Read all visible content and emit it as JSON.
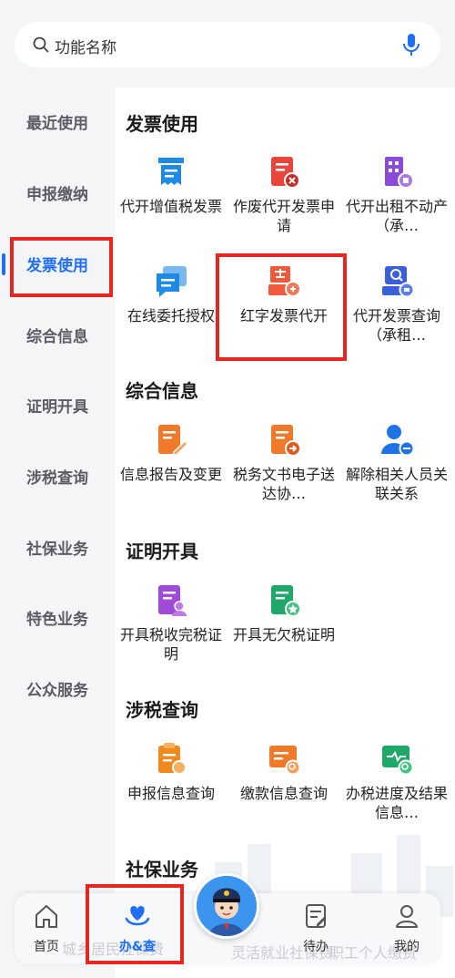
{
  "search": {
    "placeholder": "功能名称"
  },
  "sidebar": {
    "items": [
      {
        "label": "最近使用"
      },
      {
        "label": "申报缴纳"
      },
      {
        "label": "发票使用"
      },
      {
        "label": "综合信息"
      },
      {
        "label": "证明开具"
      },
      {
        "label": "涉税查询"
      },
      {
        "label": "社保业务"
      },
      {
        "label": "特色业务"
      },
      {
        "label": "公众服务"
      }
    ]
  },
  "sections": [
    {
      "title": "发票使用",
      "items": [
        {
          "label": "代开增值税发票",
          "icon": "invoice-icon",
          "color": "#1e8ae6"
        },
        {
          "label": "作废代开发票申请",
          "icon": "cancel-invoice-icon",
          "color": "#e8453c"
        },
        {
          "label": "代开出租不动产（承…",
          "icon": "building-icon",
          "color": "#8a4bd8"
        },
        {
          "label": "在线委托授权",
          "icon": "chat-authorize-icon",
          "color": "#1e8ae6"
        },
        {
          "label": "红字发票代开",
          "icon": "red-invoice-icon",
          "color": "#f05a3a"
        },
        {
          "label": "代开发票查询（承租…",
          "icon": "invoice-search-icon",
          "color": "#3a5fd8"
        }
      ]
    },
    {
      "title": "综合信息",
      "items": [
        {
          "label": "信息报告及变更",
          "icon": "edit-report-icon",
          "color": "#f07a2a"
        },
        {
          "label": "税务文书电子送达协…",
          "icon": "document-send-icon",
          "color": "#f07a2a"
        },
        {
          "label": "解除相关人员关联关系",
          "icon": "remove-user-icon",
          "color": "#1e72e6"
        }
      ]
    },
    {
      "title": "证明开具",
      "items": [
        {
          "label": "开具税收完税证明",
          "icon": "tax-certificate-icon",
          "color": "#a04bd8"
        },
        {
          "label": "开具无欠税证明",
          "icon": "no-arrears-certificate-icon",
          "color": "#1fa868"
        }
      ]
    },
    {
      "title": "涉税查询",
      "items": [
        {
          "label": "申报信息查询",
          "icon": "declare-query-icon",
          "color": "#f08a1e"
        },
        {
          "label": "缴款信息查询",
          "icon": "payment-query-icon",
          "color": "#f07a2a"
        },
        {
          "label": "办税进度及结果信息…",
          "icon": "progress-query-icon",
          "color": "#1fa868"
        }
      ]
    },
    {
      "title": "社保业务",
      "items": []
    }
  ],
  "bottom_nav": {
    "items": [
      {
        "label": "首页",
        "icon": "home-icon"
      },
      {
        "label": "办&查",
        "icon": "heart-hands-icon"
      },
      {
        "label": "待办",
        "icon": "todo-icon"
      },
      {
        "label": "我的",
        "icon": "user-icon"
      }
    ],
    "background_text": [
      "灵活就业社保费",
      "职工个人缴费",
      "城乡居民社保费"
    ]
  },
  "colors": {
    "accent": "#1f6ff2",
    "highlight": "#e8261f"
  }
}
